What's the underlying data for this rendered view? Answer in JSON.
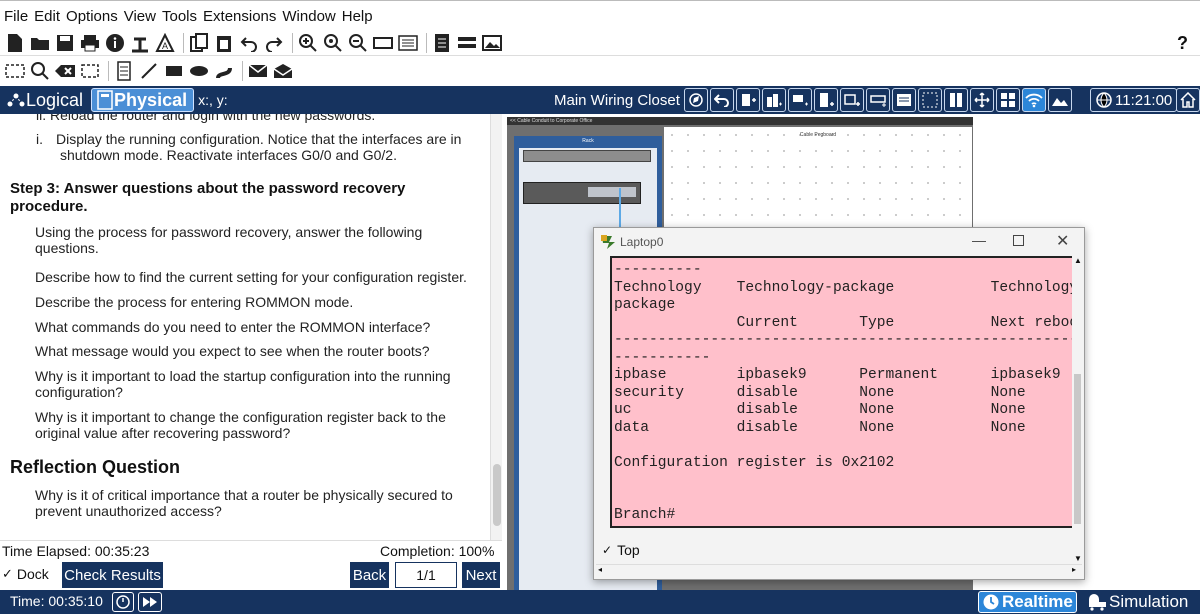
{
  "menu": [
    "File",
    "Edit",
    "Options",
    "View",
    "Tools",
    "Extensions",
    "Window",
    "Help"
  ],
  "toolbar": {
    "help_label": "?"
  },
  "modebar": {
    "logical_label": "Logical",
    "physical_label": "Physical",
    "coords": "x:, y:",
    "location": "Main Wiring Closet",
    "clock": "11:21:00"
  },
  "instructions": {
    "cut_line": "ii.   Reload the router and login with the new passwords.",
    "step_i_num": "i.",
    "step_i_line1": "Display the running configuration. Notice that the interfaces are in",
    "step_i_line2": "shutdown mode. Reactivate interfaces G0/0 and G0/2.",
    "step3_line1": "Step 3: Answer questions about the password recovery",
    "step3_line2": "procedure.",
    "intro_line1": "Using the process for password recovery, answer the following",
    "intro_line2": "questions.",
    "q1": "Describe how to find the current setting for your configuration register.",
    "q2": "Describe the process for entering ROMMON mode.",
    "q3": "What commands do you need to enter the ROMMON interface?",
    "q4": "What message would you expect to see when the router boots?",
    "q5_line1": "Why is it important to load the startup configuration into the running",
    "q5_line2": "configuration?",
    "q6_line1": "Why is it important to change the configuration register back to the",
    "q6_line2": "original value after recovering password?",
    "reflection_title": "Reflection Question",
    "r1_line1": "Why is it of critical importance that a router be physically secured to",
    "r1_line2": "prevent unauthorized access?"
  },
  "bottom": {
    "time_elapsed": "Time Elapsed: 00:35:23",
    "completion": "Completion: 100%",
    "dock_label": "Dock",
    "check_results": "Check Results",
    "back": "Back",
    "page": "1/1",
    "next": "Next"
  },
  "workspace": {
    "closet_header": "<< Cable Conduit to Corporate Office",
    "rack_label": "Rack",
    "pegboard_label": "Cable Pegboard"
  },
  "laptop": {
    "title": "Laptop0",
    "top_label": "Top",
    "terminal_lines": [
      "----------",
      "Technology    Technology-package           Technology-",
      "package",
      "              Current       Type           Next reboot",
      "-------------------------------------------------------",
      "-----------",
      "ipbase        ipbasek9      Permanent      ipbasek9",
      "security      disable       None           None",
      "uc            disable       None           None",
      "data          disable       None           None",
      "",
      "Configuration register is 0x2102",
      "",
      "",
      "Branch#"
    ]
  },
  "status": {
    "time": "Time: 00:35:10",
    "realtime": "Realtime",
    "simulation": "Simulation"
  },
  "colors": {
    "navy": "#16335f",
    "active_tab": "#4b8fd6",
    "terminal_bg": "#ffc0cb"
  }
}
